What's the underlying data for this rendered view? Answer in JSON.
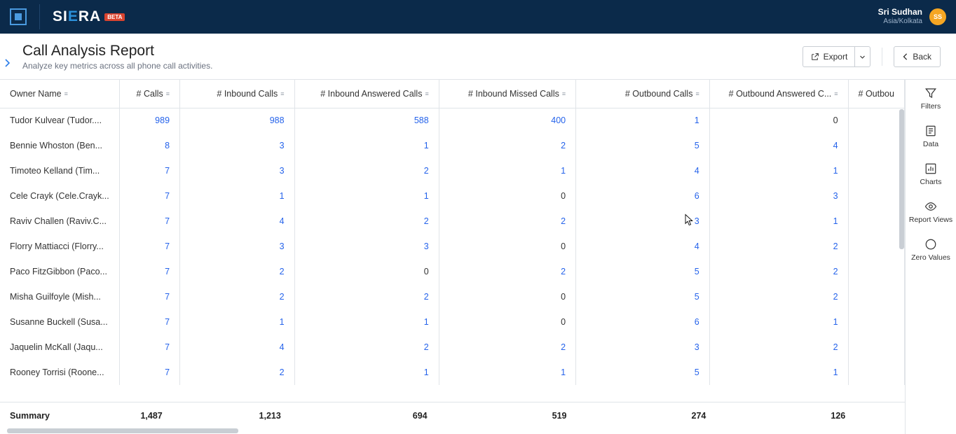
{
  "header": {
    "brand_prefix": "SI",
    "brand_e": "E",
    "brand_suffix": "RA",
    "badge": "BETA",
    "user_name": "Sri Sudhan",
    "user_tz": "Asia/Kolkata",
    "avatar_initials": "SS"
  },
  "page": {
    "title": "Call Analysis Report",
    "subtitle": "Analyze key metrics across all phone call activities.",
    "export_label": "Export",
    "back_label": "Back"
  },
  "rail": {
    "filters": "Filters",
    "data": "Data",
    "charts": "Charts",
    "views": "Report Views",
    "zero": "Zero Values"
  },
  "table": {
    "columns": {
      "owner": "Owner Name",
      "calls": "# Calls",
      "inbound": "# Inbound Calls",
      "inbound_ans": "# Inbound Answered Calls",
      "inbound_missed": "# Inbound Missed Calls",
      "outbound": "# Outbound Calls",
      "outbound_ans": "# Outbound Answered C...",
      "outbound_missed": "# Outbou"
    },
    "rows": [
      {
        "owner": "Tudor Kulvear (Tudor....",
        "calls": "989",
        "inbound": "988",
        "inbound_ans": "588",
        "inbound_missed": "400",
        "outbound": "1",
        "outbound_ans": "0"
      },
      {
        "owner": "Bennie Whoston (Ben...",
        "calls": "8",
        "inbound": "3",
        "inbound_ans": "1",
        "inbound_missed": "2",
        "outbound": "5",
        "outbound_ans": "4"
      },
      {
        "owner": "Timoteo Kelland (Tim...",
        "calls": "7",
        "inbound": "3",
        "inbound_ans": "2",
        "inbound_missed": "1",
        "outbound": "4",
        "outbound_ans": "1"
      },
      {
        "owner": "Cele Crayk (Cele.Crayk...",
        "calls": "7",
        "inbound": "1",
        "inbound_ans": "1",
        "inbound_missed": "0",
        "outbound": "6",
        "outbound_ans": "3"
      },
      {
        "owner": "Raviv Challen (Raviv.C...",
        "calls": "7",
        "inbound": "4",
        "inbound_ans": "2",
        "inbound_missed": "2",
        "outbound": "3",
        "outbound_ans": "1"
      },
      {
        "owner": "Florry Mattiacci (Florry...",
        "calls": "7",
        "inbound": "3",
        "inbound_ans": "3",
        "inbound_missed": "0",
        "outbound": "4",
        "outbound_ans": "2"
      },
      {
        "owner": "Paco FitzGibbon (Paco...",
        "calls": "7",
        "inbound": "2",
        "inbound_ans": "0",
        "inbound_missed": "2",
        "outbound": "5",
        "outbound_ans": "2"
      },
      {
        "owner": "Misha Guilfoyle (Mish...",
        "calls": "7",
        "inbound": "2",
        "inbound_ans": "2",
        "inbound_missed": "0",
        "outbound": "5",
        "outbound_ans": "2"
      },
      {
        "owner": "Susanne Buckell (Susa...",
        "calls": "7",
        "inbound": "1",
        "inbound_ans": "1",
        "inbound_missed": "0",
        "outbound": "6",
        "outbound_ans": "1"
      },
      {
        "owner": "Jaquelin McKall (Jaqu...",
        "calls": "7",
        "inbound": "4",
        "inbound_ans": "2",
        "inbound_missed": "2",
        "outbound": "3",
        "outbound_ans": "2"
      },
      {
        "owner": "Rooney Torrisi (Roone...",
        "calls": "7",
        "inbound": "2",
        "inbound_ans": "1",
        "inbound_missed": "1",
        "outbound": "5",
        "outbound_ans": "1"
      }
    ],
    "summary": {
      "label": "Summary",
      "calls": "1,487",
      "inbound": "1,213",
      "inbound_ans": "694",
      "inbound_missed": "519",
      "outbound": "274",
      "outbound_ans": "126"
    }
  }
}
